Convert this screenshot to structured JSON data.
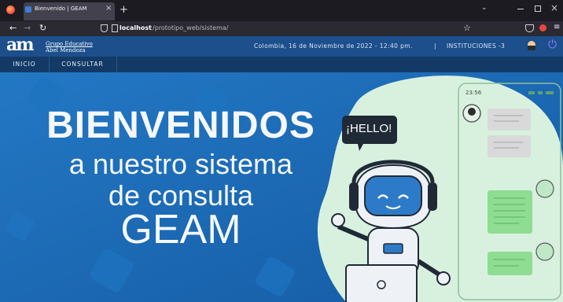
{
  "browser": {
    "tab_title": "Bienvenido | GEAM",
    "url_host": "localhost",
    "url_path": "/prototipo_web/sistema/"
  },
  "header": {
    "logo_letters": "am",
    "org_line1": "Grupo Educativo",
    "org_line2": "Abel Mendoza",
    "location_date": "Colombia, 16 de Noviembre de 2022 - 12:40 pm.",
    "separator": "|",
    "institution": "INSTITUCIONES -3"
  },
  "nav": {
    "items": [
      {
        "label": "INICIO"
      },
      {
        "label": "CONSULTAR"
      }
    ]
  },
  "hero": {
    "line1": "BIENVENIDOS",
    "line2": "a nuestro sistema",
    "line3": "de consulta",
    "line4": "GEAM",
    "bubble": "¡HELLO!",
    "phone_time": "23:56"
  },
  "colors": {
    "header": "#1c4f8c",
    "nav": "#133a66",
    "hero_bg": "#1967b4",
    "blob": "#d8f1df",
    "chat_gray": "#d9d9d9",
    "chat_green": "#8fdc93"
  }
}
